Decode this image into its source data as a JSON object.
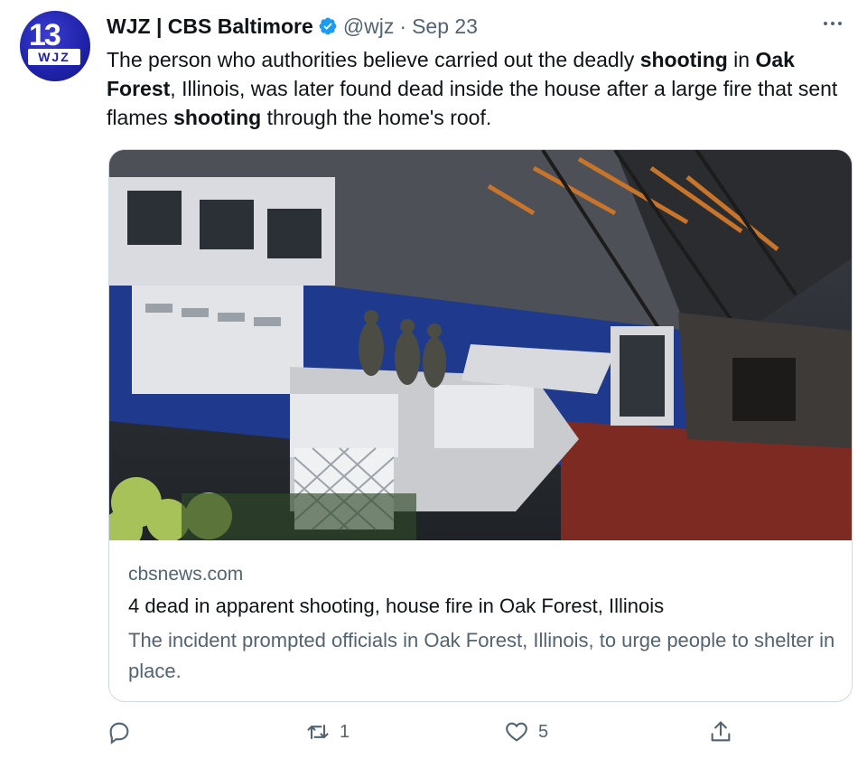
{
  "tweet": {
    "avatar": {
      "number": "13",
      "letters": "WJZ",
      "brand_color": "#1f22a8"
    },
    "display_name": "WJZ | CBS Baltimore",
    "handle": "@wjz",
    "separator": "·",
    "date": "Sep 23",
    "text_parts": [
      "The person who authorities believe carried out the deadly ",
      "shooting",
      " in ",
      "Oak Forest",
      ", Illinois, was later found dead inside the house after a large fire that sent flames ",
      "shooting",
      " through the home's roof."
    ]
  },
  "card": {
    "domain": "cbsnews.com",
    "title": "4 dead in apparent shooting, house fire in Oak Forest, Illinois",
    "description": "The incident prompted officials in Oak Forest, Illinois, to urge people to shelter in place."
  },
  "actions": {
    "reply_count": "",
    "retweet_count": "1",
    "like_count": "5"
  },
  "colors": {
    "accent": "#1d9bf0",
    "secondary_text": "#536471",
    "border": "#cfd9de"
  }
}
